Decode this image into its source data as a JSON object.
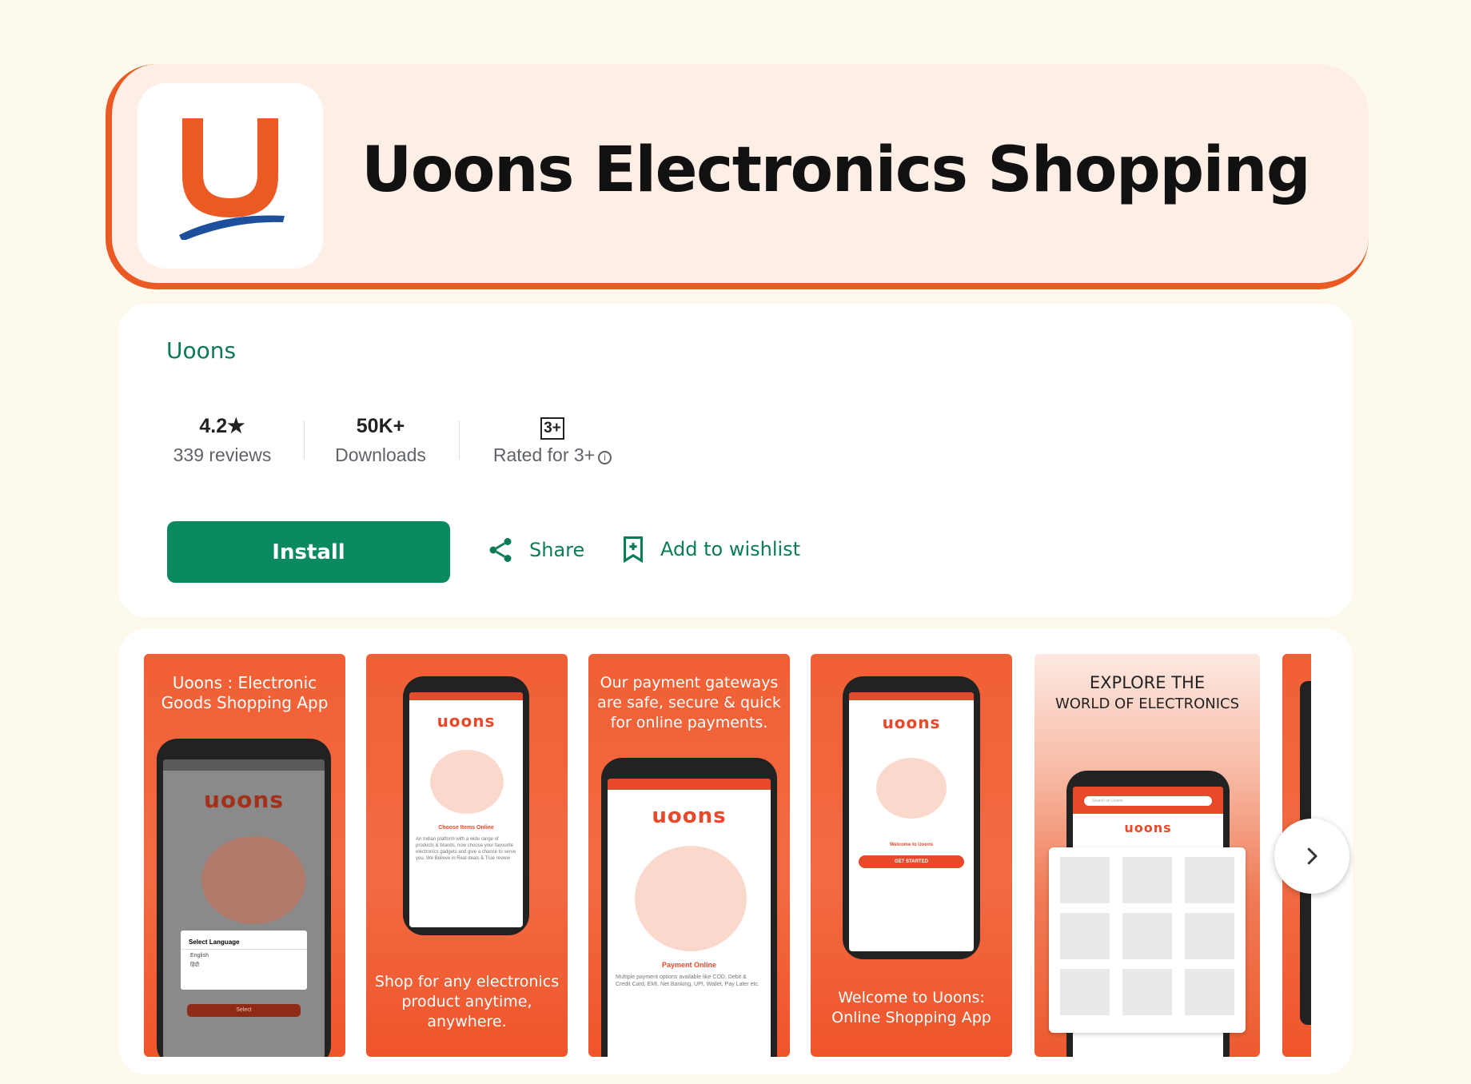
{
  "header": {
    "title": "Uoons Electronics Shopping",
    "icon": "uoons-logo-icon",
    "colors": {
      "brand_orange": "#ec5a24",
      "brand_blue": "#1e4f9c"
    }
  },
  "info": {
    "developer": "Uoons",
    "stats": [
      {
        "value": "4.2★",
        "label": "339 reviews"
      },
      {
        "value": "50K+",
        "label": "Downloads"
      },
      {
        "value": "3+",
        "label": "Rated for 3+"
      }
    ],
    "install_label": "Install",
    "share_label": "Share",
    "wishlist_label": "Add to wishlist",
    "accent": "#0b8a5e"
  },
  "screenshots": [
    {
      "caption": "Uoons : Electronic Goods Shopping App",
      "brand": "uoons",
      "dialog_title": "Select Language",
      "options": [
        "English",
        "हिंदी"
      ],
      "button": "Select"
    },
    {
      "caption": "Shop for any electronics product anytime, anywhere.",
      "brand": "uoons",
      "screen_title": "Choose Items Online",
      "screen_text": "An Indian platform with a wide range of products & brands, now choose your favourite electronics gadgets and give a chance to serve you. We Believe in Real deals & True review"
    },
    {
      "caption": "Our payment gateways are safe, secure & quick for online payments.",
      "brand": "uoons",
      "screen_title": "Payment Online",
      "screen_text": "Multiple payment options available like COD, Debit & Credit Card, EMI, Net Banking, UPI, Wallet, Pay Later etc."
    },
    {
      "caption": "Welcome to Uoons: Online Shopping App",
      "brand": "uoons",
      "screen_title": "Welcome to Uoons",
      "button": "GET STARTED"
    },
    {
      "caption_line1": "EXPLORE THE",
      "caption_line2": "WORLD OF ELECTRONICS",
      "brand": "uoons",
      "search_placeholder": "Search on Uoons"
    }
  ],
  "next_icon": "chevron-right-icon"
}
